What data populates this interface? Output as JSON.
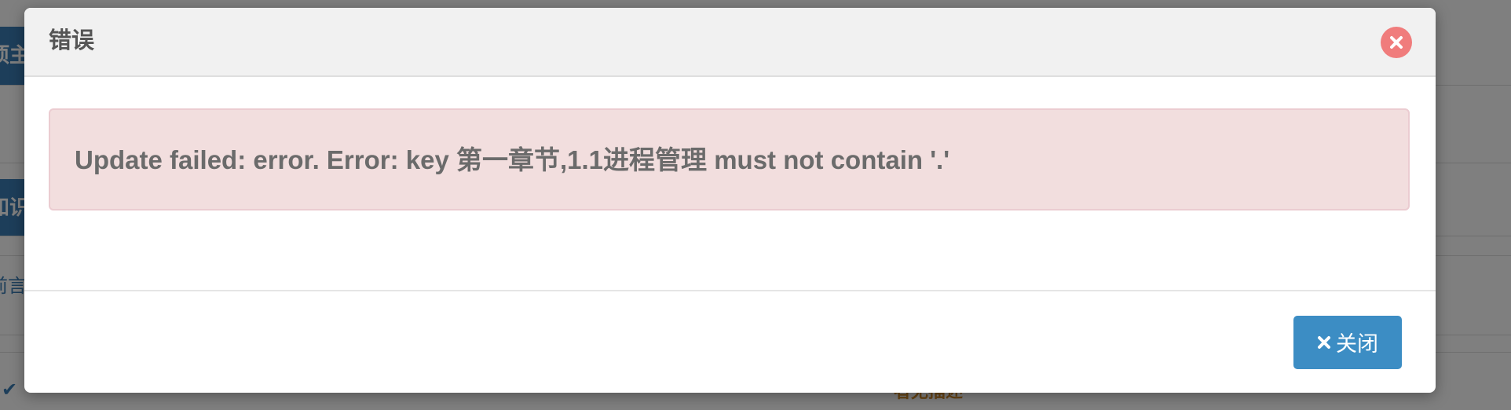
{
  "background": {
    "tab1_label": "项主",
    "tab2_label": "知识点",
    "link_label": "前言",
    "check_icon": "check-icon",
    "orange_text": "者无描述"
  },
  "modal": {
    "title": "错误",
    "close_icon": "close-circle-icon",
    "alert_message": "Update failed: error. Error: key 第一章节,1.1进程管理 must not contain '.'",
    "footer": {
      "close_button_icon": "x-icon",
      "close_button_label": "关闭"
    }
  },
  "colors": {
    "primary": "#3c8dc4",
    "alert_bg": "#f2dede",
    "alert_border": "#ebccd1",
    "close_circle": "#f07c7c",
    "header_bg": "#f1f1f1"
  }
}
